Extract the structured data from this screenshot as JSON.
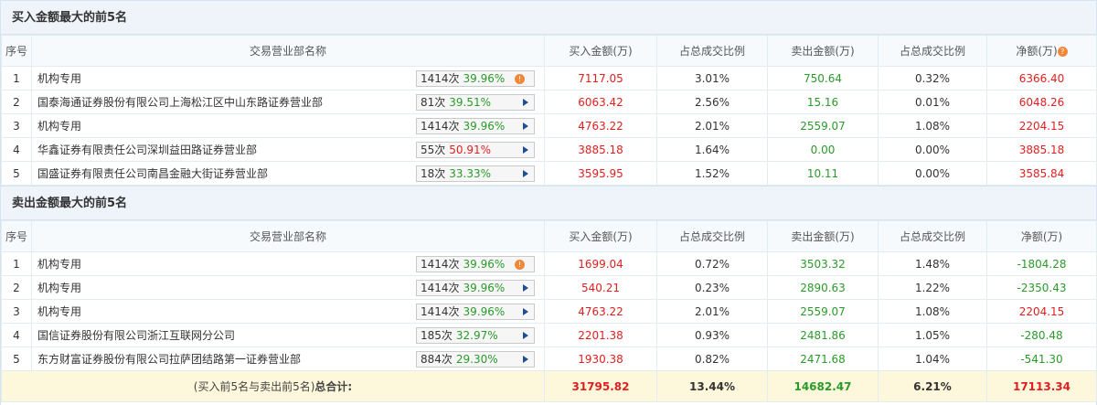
{
  "buy_section": {
    "title": "买入金额最大的前5名",
    "headers": {
      "idx": "序号",
      "name": "交易营业部名称",
      "buy": "买入金额(万)",
      "buy_ratio": "占总成交比例",
      "sell": "卖出金额(万)",
      "sell_ratio": "占总成交比例",
      "net": "净额(万)"
    },
    "rows": [
      {
        "idx": "1",
        "name": "机构专用",
        "times": "1414次",
        "rate": "39.96%",
        "rate_color": "green",
        "icon": "info-dot-icon",
        "buy": "7117.05",
        "buy_ratio": "3.01%",
        "sell": "750.64",
        "sell_ratio": "0.32%",
        "net": "6366.40"
      },
      {
        "idx": "2",
        "name": "国泰海通证券股份有限公司上海松江区中山东路证券营业部",
        "times": "81次",
        "rate": "39.51%",
        "rate_color": "green",
        "icon": "play-arrow-icon",
        "buy": "6063.42",
        "buy_ratio": "2.56%",
        "sell": "15.16",
        "sell_ratio": "0.01%",
        "net": "6048.26"
      },
      {
        "idx": "3",
        "name": "机构专用",
        "times": "1414次",
        "rate": "39.96%",
        "rate_color": "green",
        "icon": "play-arrow-icon",
        "buy": "4763.22",
        "buy_ratio": "2.01%",
        "sell": "2559.07",
        "sell_ratio": "1.08%",
        "net": "2204.15"
      },
      {
        "idx": "4",
        "name": "华鑫证券有限责任公司深圳益田路证券营业部",
        "times": "55次",
        "rate": "50.91%",
        "rate_color": "red",
        "icon": "play-arrow-icon",
        "buy": "3885.18",
        "buy_ratio": "1.64%",
        "sell": "0.00",
        "sell_ratio": "0.00%",
        "net": "3885.18"
      },
      {
        "idx": "5",
        "name": "国盛证券有限责任公司南昌金融大街证券营业部",
        "times": "18次",
        "rate": "33.33%",
        "rate_color": "green",
        "icon": "play-arrow-icon",
        "buy": "3595.95",
        "buy_ratio": "1.52%",
        "sell": "10.11",
        "sell_ratio": "0.00%",
        "net": "3585.84"
      }
    ]
  },
  "sell_section": {
    "title": "卖出金额最大的前5名",
    "headers": {
      "idx": "序号",
      "name": "交易营业部名称",
      "buy": "买入金额(万)",
      "buy_ratio": "占总成交比例",
      "sell": "卖出金额(万)",
      "sell_ratio": "占总成交比例",
      "net": "净额(万)"
    },
    "rows": [
      {
        "idx": "1",
        "name": "机构专用",
        "times": "1414次",
        "rate": "39.96%",
        "rate_color": "green",
        "icon": "info-dot-icon",
        "buy": "1699.04",
        "buy_ratio": "0.72%",
        "sell": "3503.32",
        "sell_ratio": "1.48%",
        "net": "-1804.28"
      },
      {
        "idx": "2",
        "name": "机构专用",
        "times": "1414次",
        "rate": "39.96%",
        "rate_color": "green",
        "icon": "play-arrow-icon",
        "buy": "540.21",
        "buy_ratio": "0.23%",
        "sell": "2890.63",
        "sell_ratio": "1.22%",
        "net": "-2350.43"
      },
      {
        "idx": "3",
        "name": "机构专用",
        "times": "1414次",
        "rate": "39.96%",
        "rate_color": "green",
        "icon": "play-arrow-icon",
        "buy": "4763.22",
        "buy_ratio": "2.01%",
        "sell": "2559.07",
        "sell_ratio": "1.08%",
        "net": "2204.15"
      },
      {
        "idx": "4",
        "name": "国信证券股份有限公司浙江互联网分公司",
        "times": "185次",
        "rate": "32.97%",
        "rate_color": "green",
        "icon": "play-arrow-icon",
        "buy": "2201.38",
        "buy_ratio": "0.93%",
        "sell": "2481.86",
        "sell_ratio": "1.05%",
        "net": "-280.48"
      },
      {
        "idx": "5",
        "name": "东方财富证券股份有限公司拉萨团结路第一证券营业部",
        "times": "884次",
        "rate": "29.30%",
        "rate_color": "green",
        "icon": "play-arrow-icon",
        "buy": "1930.38",
        "buy_ratio": "0.82%",
        "sell": "2471.68",
        "sell_ratio": "1.04%",
        "net": "-541.30"
      }
    ],
    "total": {
      "label_normal": "(买入前5名与卖出前5名)",
      "label_bold": "总合计:",
      "buy": "31795.82",
      "buy_ratio": "13.44%",
      "sell": "14682.47",
      "sell_ratio": "6.21%",
      "net": "17113.34"
    }
  },
  "colors": {
    "buy_value": "#e02020",
    "sell_value": "#2a9a2a",
    "header_bg": "#eef4fa",
    "total_bg": "#fdf7dc"
  }
}
